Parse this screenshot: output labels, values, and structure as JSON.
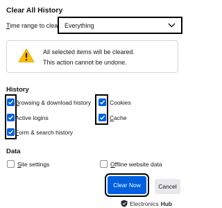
{
  "dialog": {
    "title": "Clear All History",
    "time_range_label_prefix": "",
    "time_range_label_mnemonic": "T",
    "time_range_label_rest": "ime range to clear:",
    "time_range_value": "Everything",
    "warning_line1": "All selected items will be cleared.",
    "warning_line2": "This action cannot be undone."
  },
  "history": {
    "heading": "History",
    "items": [
      {
        "mn": "B",
        "rest": "rowsing & download history",
        "checked": true
      },
      {
        "mn": "A",
        "rest": "ctive logins",
        "checked": true
      },
      {
        "mn": "F",
        "rest": "orm & search history",
        "checked": true
      },
      {
        "mn": "C",
        "rest": "ookies",
        "checked": true
      },
      {
        "mn": "C",
        "rest": "ache",
        "checked": true
      }
    ]
  },
  "data_section": {
    "heading": "Data",
    "items": [
      {
        "mn": "S",
        "rest": "ite settings",
        "checked": false
      },
      {
        "mn": "O",
        "rest": "ffline website data",
        "checked": false
      }
    ]
  },
  "buttons": {
    "clear": "Clear Now",
    "cancel": "Cancel"
  },
  "watermark": {
    "part1": "Electronics",
    "part2": "Hub"
  },
  "colors": {
    "accent": "#0060df",
    "highlight_border": "#000000",
    "warning": "#ffbf00"
  },
  "icons": {
    "warning": "warning-triangle-icon",
    "dropdown": "chevron-down-icon",
    "check": "checkmark-icon"
  }
}
